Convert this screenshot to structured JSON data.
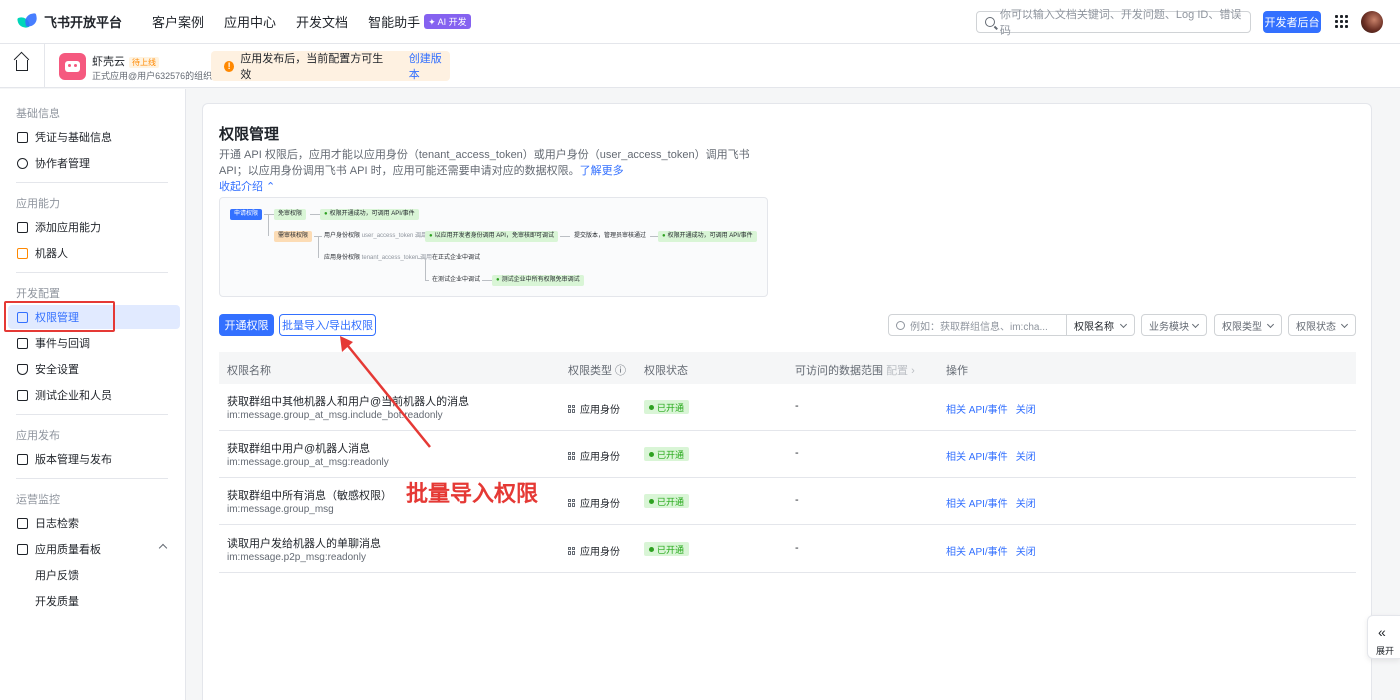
{
  "topnav": {
    "logo": "飞书开放平台",
    "links": [
      "客户案例",
      "应用中心",
      "开发文档",
      "智能助手"
    ],
    "ai_badge": "✦ AI 开发",
    "search_placeholder": "你可以输入文档关键词、开发问题、Log ID、错误码",
    "dev_button": "开发者后台"
  },
  "appbar": {
    "app_name": "虾壳云",
    "app_status": "待上线",
    "app_sub": "正式应用@用户632576的组织",
    "notice": "应用发布后，当前配置方可生效",
    "notice_link": "创建版本"
  },
  "sidebar": {
    "sections": [
      {
        "title": "基础信息",
        "items": [
          "凭证与基础信息",
          "协作者管理"
        ]
      },
      {
        "title": "应用能力",
        "items": [
          "添加应用能力",
          "机器人"
        ]
      },
      {
        "title": "开发配置",
        "items": [
          "权限管理",
          "事件与回调",
          "安全设置",
          "测试企业和人员"
        ]
      },
      {
        "title": "应用发布",
        "items": [
          "版本管理与发布"
        ]
      },
      {
        "title": "运营监控",
        "items": [
          "日志检索",
          "应用质量看板",
          "用户反馈",
          "开发质量"
        ]
      }
    ],
    "active": "权限管理"
  },
  "main": {
    "title": "权限管理",
    "intro": "开通 API 权限后，应用才能以应用身份（tenant_access_token）或用户身份（user_access_token）调用飞书 API；以应用身份调用飞书 API 时，应用可能还需要申请对应的数据权限。",
    "learn_more": "了解更多",
    "collapse": "收起介绍 ⌃",
    "flow": {
      "apply": "申请权限",
      "free": "免审权限",
      "free_ok": "权限开通成功，可调用 API/事件",
      "review": "需审核权限",
      "user_perm": "用户身份权限",
      "user_token": "user_access_token 调用",
      "user_ok": "以应用开发者身份调用 API，免审核即可调试",
      "submit": "提交版本，管理员审核通过",
      "final_ok": "权限开通成功，可调用 API/事件",
      "app_perm": "应用身份权限",
      "tenant_token": "tenant_access_token 调用",
      "formal": "在正式企业中调试",
      "test": "在测试企业中调试",
      "test_ok": "测试企业中所有权限免审调试"
    },
    "btn_open": "开通权限",
    "btn_batch": "批量导入/导出权限",
    "filter_placeholder": "例如：获取群组信息、im:cha...",
    "filters": [
      "权限名称",
      "业务模块",
      "权限类型",
      "权限状态"
    ],
    "columns": {
      "name": "权限名称",
      "type": "权限类型 ⓘ",
      "status": "权限状态",
      "scope": "可访问的数据范围",
      "scope_cfg": "配置 ›",
      "ops": "操作"
    },
    "rows": [
      {
        "name": "获取群组中其他机器人和用户@当前机器人的消息",
        "key": "im:message.group_at_msg.include_bot:readonly",
        "type": "应用身份",
        "status": "已开通",
        "scope": "-",
        "act1": "相关 API/事件",
        "act2": "关闭"
      },
      {
        "name": "获取群组中用户@机器人消息",
        "key": "im:message.group_at_msg:readonly",
        "type": "应用身份",
        "status": "已开通",
        "scope": "-",
        "act1": "相关 API/事件",
        "act2": "关闭"
      },
      {
        "name": "获取群组中所有消息（敏感权限）",
        "key": "im:message.group_msg",
        "type": "应用身份",
        "status": "已开通",
        "scope": "-",
        "act1": "相关 API/事件",
        "act2": "关闭"
      },
      {
        "name": "读取用户发给机器人的单聊消息",
        "key": "im:message.p2p_msg:readonly",
        "type": "应用身份",
        "status": "已开通",
        "scope": "-",
        "act1": "相关 API/事件",
        "act2": "关闭"
      }
    ]
  },
  "annotation": "批量导入权限",
  "expand_label": "展开",
  "colors": {
    "accent": "#3370ff",
    "annotation_red": "#e53935",
    "success": "#2ea121"
  }
}
